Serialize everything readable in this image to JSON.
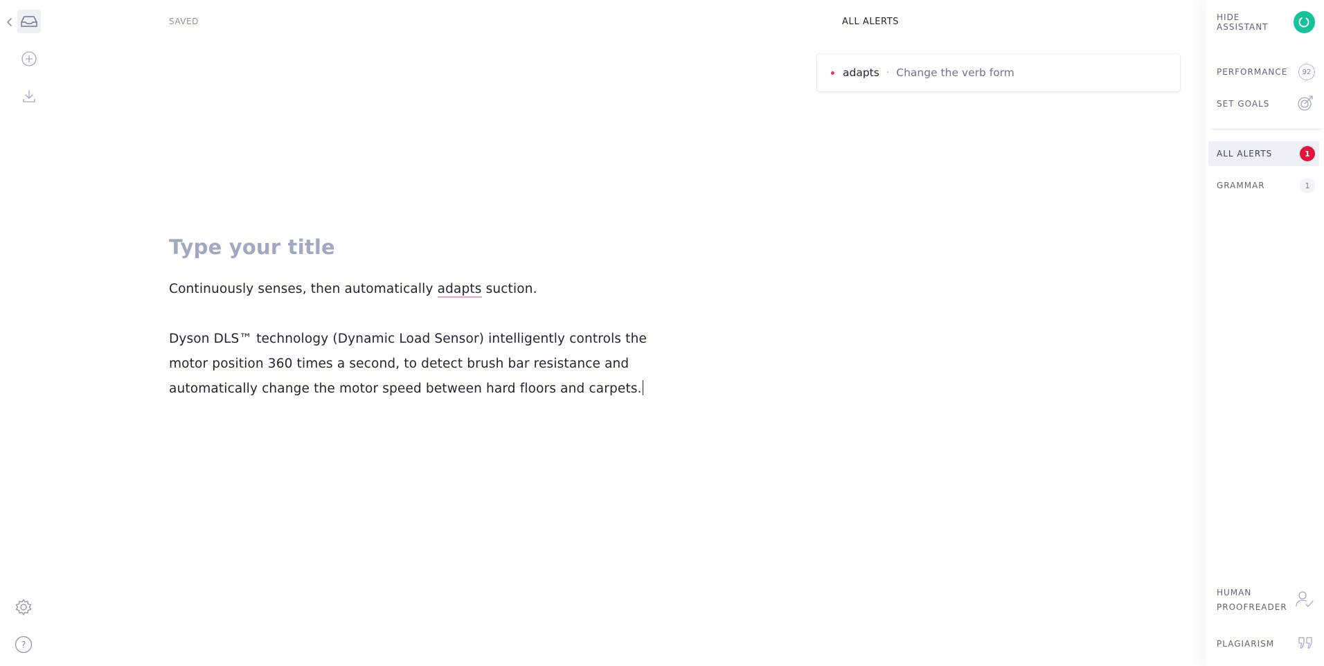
{
  "left_rail": {
    "icons": [
      "chevron-left-icon",
      "inbox-icon",
      "plus-circle-icon",
      "download-icon",
      "gear-icon",
      "question-icon"
    ]
  },
  "editor": {
    "status": "SAVED",
    "title_placeholder": "Type your title",
    "paragraph1": {
      "before": "Continuously senses, then automatically ",
      "flagged": "adapts",
      "after": " suction."
    },
    "paragraph2": {
      "line1": "Dyson DLS™ technology (Dynamic Load Sensor) intelligently controls the",
      "line2": "motor position 360 times a second, to detect brush bar resistance and",
      "line3": "automatically change the motor speed between hard floors and carpets."
    }
  },
  "alerts": {
    "header": "ALL ALERTS",
    "items": [
      {
        "word": "adapts",
        "separator": "·",
        "description": "Change the verb form",
        "color": "#e5385a"
      }
    ]
  },
  "sidebar": {
    "hide_assistant": "HIDE ASSISTANT",
    "performance": {
      "label": "PERFORMANCE",
      "score": "92"
    },
    "set_goals": "SET GOALS",
    "all_alerts": {
      "label": "ALL ALERTS",
      "count": "1",
      "color": "#e4123c"
    },
    "grammar": {
      "label": "GRAMMAR",
      "count": "1"
    },
    "human_proofreader": {
      "line1": "HUMAN",
      "line2": "PROOFREADER"
    },
    "plagiarism": "PLAGIARISM",
    "accent_color": "#15c39a"
  }
}
